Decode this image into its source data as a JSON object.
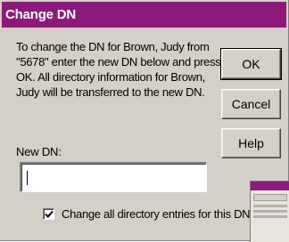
{
  "window": {
    "title": "Change DN"
  },
  "message": {
    "text": "To change the DN for Brown, Judy from \"5678\" enter the new DN below and press OK. All directory information for Brown, Judy will be transferred to the new DN."
  },
  "buttons": {
    "ok": "OK",
    "cancel": "Cancel",
    "help": "Help"
  },
  "new_dn": {
    "label": "New DN:",
    "value": ""
  },
  "change_all": {
    "label": "Change all directory entries for this DN",
    "checked": true
  },
  "colors": {
    "titlebar": "#8b1a7a",
    "dialog_bg": "#d4d0c8"
  }
}
